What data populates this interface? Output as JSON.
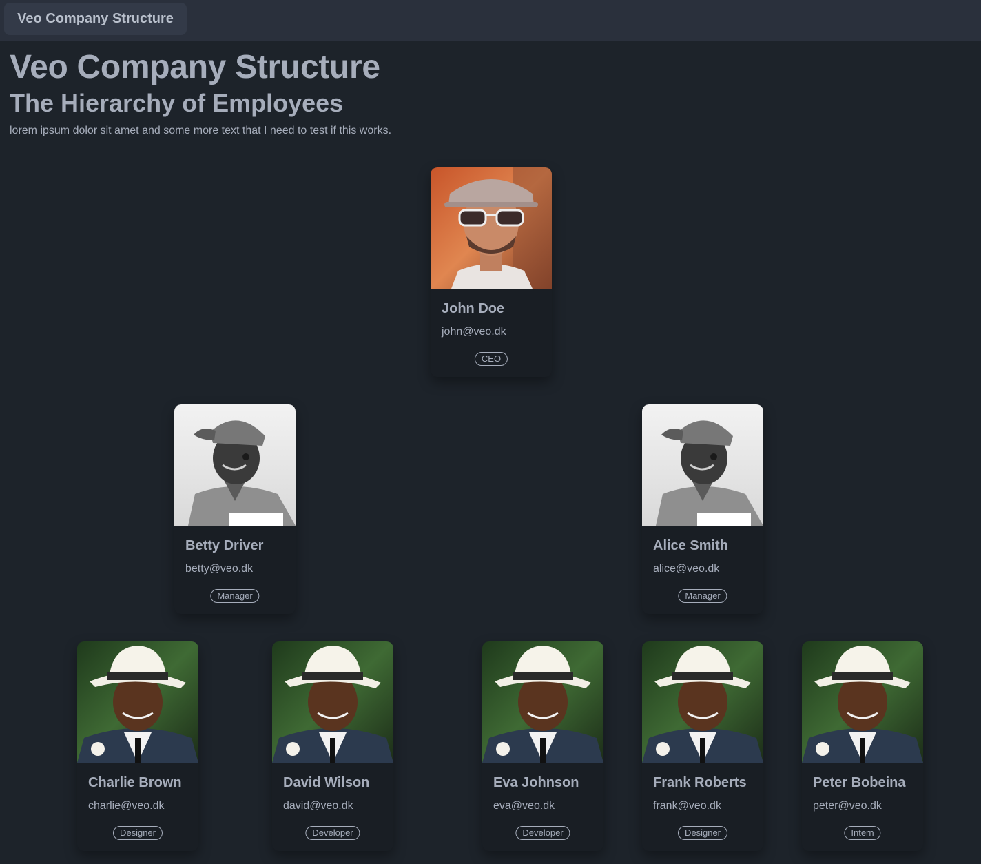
{
  "navbar": {
    "brand_label": "Veo Company Structure"
  },
  "header": {
    "title": "Veo Company Structure",
    "subtitle": "The Hierarchy of Employees",
    "description": "lorem ipsum dolor sit amet and some more text that I need to test if this works."
  },
  "colors": {
    "background": "#1d232a",
    "navbar": "#2a303c",
    "card": "#191e24",
    "text": "#a6adbb"
  },
  "employees": {
    "ceo": {
      "name": "John Doe",
      "email": "john@veo.dk",
      "role": "CEO",
      "photo": "man-sunglasses-cap-photo"
    },
    "betty": {
      "name": "Betty Driver",
      "email": "betty@veo.dk",
      "role": "Manager",
      "photo": "young-man-cap-bw-photo"
    },
    "alice": {
      "name": "Alice Smith",
      "email": "alice@veo.dk",
      "role": "Manager",
      "photo": "young-man-cap-bw-photo"
    },
    "charlie": {
      "name": "Charlie Brown",
      "email": "charlie@veo.dk",
      "role": "Designer",
      "photo": "man-white-hat-suit-photo"
    },
    "david": {
      "name": "David Wilson",
      "email": "david@veo.dk",
      "role": "Developer",
      "photo": "man-white-hat-suit-photo"
    },
    "eva": {
      "name": "Eva Johnson",
      "email": "eva@veo.dk",
      "role": "Developer",
      "photo": "man-white-hat-suit-photo"
    },
    "frank": {
      "name": "Frank Roberts",
      "email": "frank@veo.dk",
      "role": "Designer",
      "photo": "man-white-hat-suit-photo"
    },
    "peter": {
      "name": "Peter Bobeina",
      "email": "peter@veo.dk",
      "role": "Intern",
      "photo": "man-white-hat-suit-photo"
    }
  }
}
